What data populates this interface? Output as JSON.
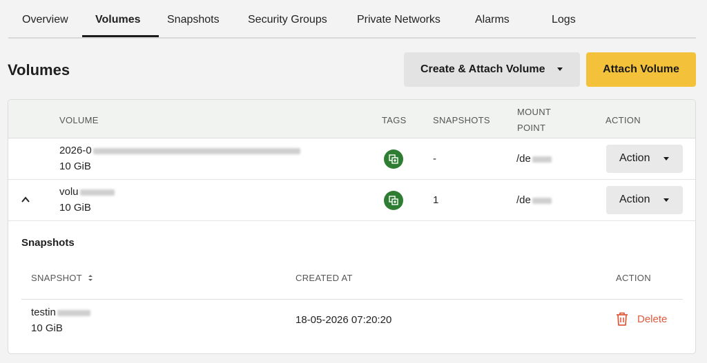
{
  "tabs": [
    {
      "label": "Overview"
    },
    {
      "label": "Volumes",
      "active": true
    },
    {
      "label": "Snapshots"
    },
    {
      "label": "Security Groups"
    },
    {
      "label": "Private Networks"
    },
    {
      "label": "Alarms"
    },
    {
      "label": "Logs"
    }
  ],
  "header": {
    "title": "Volumes",
    "create_attach_label": "Create & Attach Volume",
    "attach_label": "Attach Volume"
  },
  "table": {
    "columns": {
      "volume": "VOLUME",
      "tags": "TAGS",
      "snapshots": "SNAPSHOTS",
      "mount_point_1": "MOUNT",
      "mount_point_2": "POINT",
      "action": "ACTION"
    },
    "rows": [
      {
        "name_prefix": "2026-0",
        "size": "10 GiB",
        "snapshots": "-",
        "mount_prefix": "/de",
        "action_label": "Action"
      },
      {
        "name_prefix": "volu",
        "size": "10 GiB",
        "snapshots": "1",
        "mount_prefix": "/de",
        "action_label": "Action"
      }
    ]
  },
  "snapshots_section": {
    "title": "Snapshots",
    "columns": {
      "snapshot": "SNAPSHOT",
      "created_at": "CREATED AT",
      "action": "ACTION"
    },
    "rows": [
      {
        "name_prefix": "testin",
        "size": "10 GiB",
        "created_at": "18-05-2026 07:20:20",
        "delete_label": "Delete"
      }
    ]
  },
  "colors": {
    "accent": "#f3c13a",
    "tag_green": "#2e7d32",
    "danger": "#e05a3c"
  }
}
